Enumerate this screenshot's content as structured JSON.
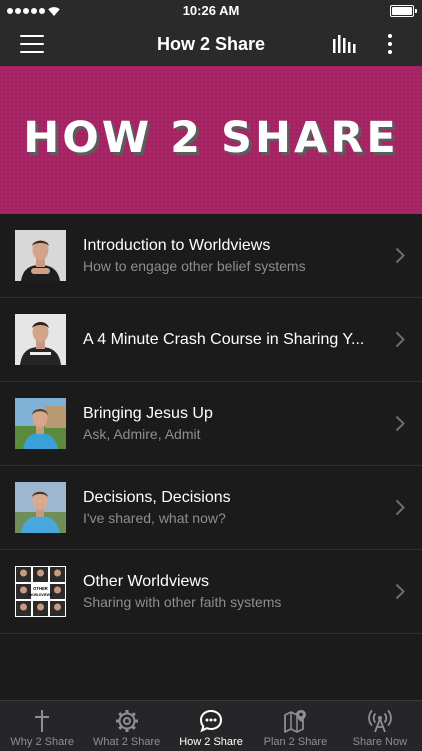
{
  "status_bar": {
    "time": "10:26 AM"
  },
  "header": {
    "title": "How 2 Share",
    "menu_icon": "hamburger-icon",
    "chart_icon": "bar-chart-icon",
    "more_icon": "vertical-ellipsis-icon"
  },
  "banner": {
    "title": "HOW 2 SHARE",
    "background": "#a52363"
  },
  "videos": [
    {
      "title": "Introduction to Worldviews",
      "subtitle": "How to engage other belief systems"
    },
    {
      "title": "A 4 Minute Crash Course in Sharing Y...",
      "subtitle": ""
    },
    {
      "title": "Bringing Jesus Up",
      "subtitle": "Ask, Admire, Admit"
    },
    {
      "title": "Decisions, Decisions",
      "subtitle": "I've shared, what now?"
    },
    {
      "title": "Other Worldviews",
      "subtitle": "Sharing with other faith systems",
      "thumb_text": "OTHER WORLDVIEWS"
    }
  ],
  "tabs": [
    {
      "label": "Why 2 Share",
      "icon": "cross-icon"
    },
    {
      "label": "What 2 Share",
      "icon": "gear-icon"
    },
    {
      "label": "How 2 Share",
      "icon": "chat-bubble-icon",
      "active": true
    },
    {
      "label": "Plan 2 Share",
      "icon": "map-pin-icon"
    },
    {
      "label": "Share Now",
      "icon": "broadcast-icon"
    }
  ],
  "colors": {
    "accent": "#a52363",
    "background": "#1b1b1c",
    "bar": "#2a2a2b",
    "subtitle": "#8e8e93"
  }
}
